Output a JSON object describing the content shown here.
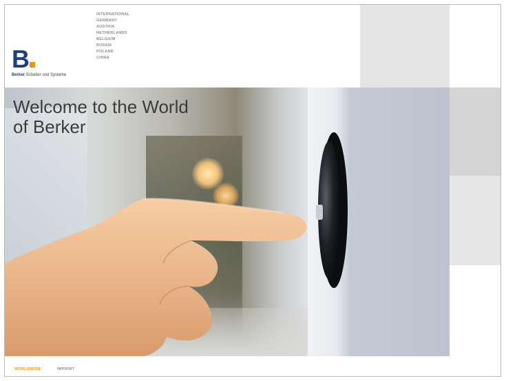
{
  "logo": {
    "mark": "B",
    "brand": "Berker",
    "tagline": "Schalter und Systeme"
  },
  "countries": [
    "INTERNATIONAL",
    "GERMANY",
    "AUSTRIA",
    "NETHERLANDS",
    "BELGIUM",
    "RUSSIA",
    "POLAND",
    "CHINA"
  ],
  "hero": {
    "title_line1": "Welcome to the World",
    "title_line2": "of Berker"
  },
  "footer": {
    "worldwide": "WORLDWIDE",
    "imprint": "IMPRINT"
  },
  "colors": {
    "brand_blue": "#1d3f86",
    "accent_orange": "#f39300",
    "nav_grey": "#8c8c8c"
  }
}
